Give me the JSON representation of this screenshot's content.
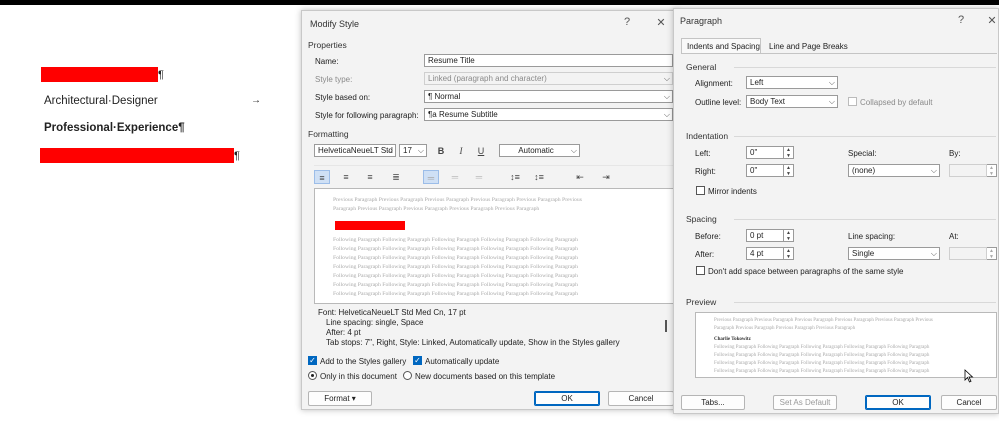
{
  "document": {
    "line2": "Architectural·Designer",
    "tab_arrow": "→",
    "line3": "Professional·Experience¶",
    "pilcrow": "¶"
  },
  "modify": {
    "title": "Modify Style",
    "help": "?",
    "close": "✕",
    "properties_label": "Properties",
    "name_label": "Name:",
    "name_value": "Resume Title",
    "style_type_label": "Style type:",
    "style_type_value": "Linked (paragraph and character)",
    "based_on_label": "Style based on:",
    "based_on_value": "Normal",
    "following_label": "Style for following paragraph:",
    "following_value": "Resume Subtitle",
    "formatting_label": "Formatting",
    "font_value": "HelveticaNeueLT Std",
    "size_value": "17",
    "bold": "B",
    "italic": "I",
    "underline": "U",
    "color_value": "Automatic",
    "preview_prev": "Previous Paragraph Previous Paragraph Previous Paragraph Previous Paragraph Previous Paragraph Previous",
    "preview_prev2": "Paragraph Previous Paragraph Previous Paragraph Previous Paragraph Previous Paragraph",
    "preview_follow": "Following Paragraph Following Paragraph Following Paragraph Following Paragraph Following Paragraph",
    "desc_line1": "Font: HelveticaNeueLT Std Med Cn, 17 pt",
    "desc_line2": "Line spacing:  single, Space",
    "desc_line3": "After:  4 pt",
    "desc_line4": "Tab stops:  7\", Right, Style: Linked, Automatically update, Show in the Styles gallery",
    "add_gallery": "Add to the Styles gallery",
    "auto_update": "Automatically update",
    "only_doc": "Only in this document",
    "new_docs": "New documents based on this template",
    "format_btn": "Format ▾",
    "ok": "OK",
    "cancel": "Cancel"
  },
  "paragraph": {
    "title": "Paragraph",
    "help": "?",
    "close": "✕",
    "tab_indents": "Indents and Spacing",
    "tab_breaks": "Line and Page Breaks",
    "general_label": "General",
    "alignment_label": "Alignment:",
    "alignment_value": "Left",
    "outline_label": "Outline level:",
    "outline_value": "Body Text",
    "collapsed": "Collapsed by default",
    "indentation_label": "Indentation",
    "left_label": "Left:",
    "left_value": "0\"",
    "right_label": "Right:",
    "right_value": "0\"",
    "special_label": "Special:",
    "special_value": "(none)",
    "by_label": "By:",
    "mirror": "Mirror indents",
    "spacing_label": "Spacing",
    "before_label": "Before:",
    "before_value": "0 pt",
    "after_label": "After:",
    "after_value": "4 pt",
    "line_spacing_label": "Line spacing:",
    "line_spacing_value": "Single",
    "at_label": "At:",
    "dont_add": "Don't add space between paragraphs of the same style",
    "preview_label": "Preview",
    "pv_prev": "Previous Paragraph Previous Paragraph Previous Paragraph Previous Paragraph Previous Paragraph Previous",
    "pv_prev2": "Paragraph Previous Paragraph Previous Paragraph Previous Paragraph",
    "pv_name": "Charlie Tokowitz",
    "pv_follow": "Following Paragraph Following Paragraph Following Paragraph Following Paragraph Following Paragraph",
    "tabs_btn": "Tabs...",
    "default_btn": "Set As Default",
    "ok": "OK",
    "cancel": "Cancel"
  },
  "colors": {
    "redaction": "#ff0000",
    "accent": "#0067c0"
  }
}
